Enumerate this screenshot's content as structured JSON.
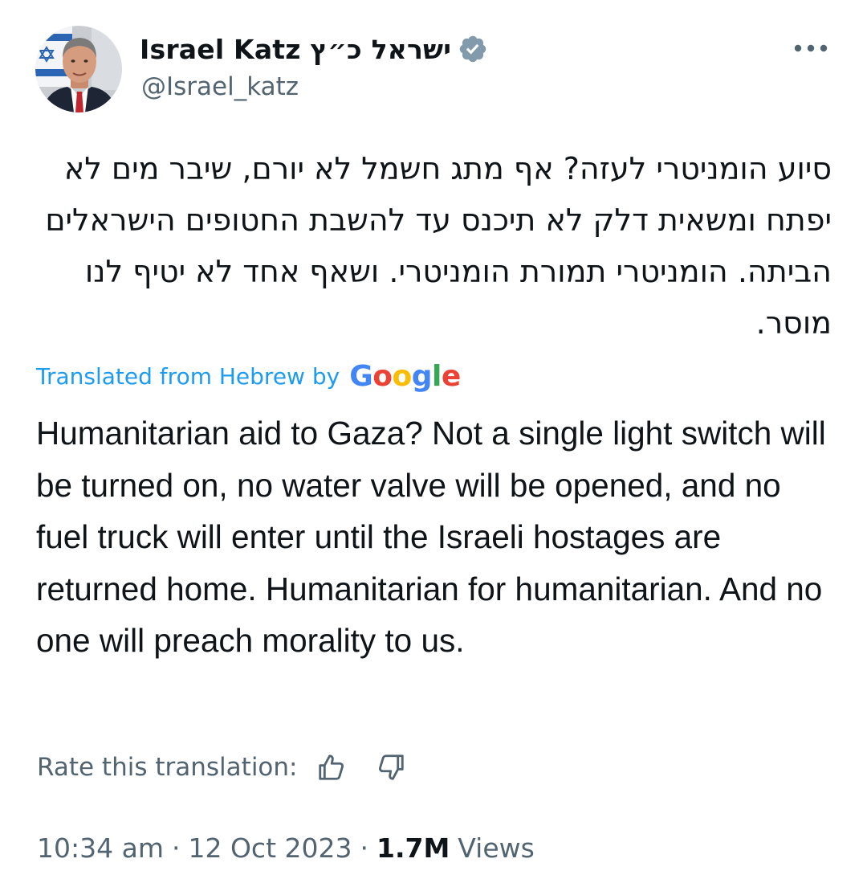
{
  "author": {
    "display_name": "ישראל כ״ץ Israel Katz",
    "handle": "@Israel_katz",
    "verified_icon": "verified-badge-icon",
    "verified_color": "#829aab"
  },
  "more_icon": "more-horizontal-icon",
  "tweet": {
    "text_hebrew": "סיוע הומניטרי לעזה? אף מתג חשמל לא יורם, שיבר מים לא יפתח ומשאית דלק לא תיכנס עד להשבת החטופים הישראלים הביתה. הומניטרי תמורת הומניטרי. ושאף אחד לא יטיף לנו מוסר.",
    "translated_from": "Translated from Hebrew by",
    "translator_logo": "Google",
    "text_english": "Humanitarian aid to Gaza? Not a single light switch will be turned on, no water valve will be opened, and no fuel truck will enter until the Israeli hostages are returned home. Humanitarian for humanitarian. And no one will preach morality to us."
  },
  "rating": {
    "label": "Rate this translation:",
    "thumbs_up_icon": "thumbs-up-icon",
    "thumbs_down_icon": "thumbs-down-icon"
  },
  "meta": {
    "time": "10:34 am",
    "separator": "·",
    "date": "12 Oct 2023",
    "views_count": "1.7M",
    "views_label": "Views"
  },
  "colors": {
    "link": "#1d9bf0",
    "secondary_text": "#536471",
    "primary_text": "#0f1419",
    "google_blue": "#4285f4",
    "google_red": "#ea4335",
    "google_yellow": "#fbbc05",
    "google_green": "#34a853"
  }
}
